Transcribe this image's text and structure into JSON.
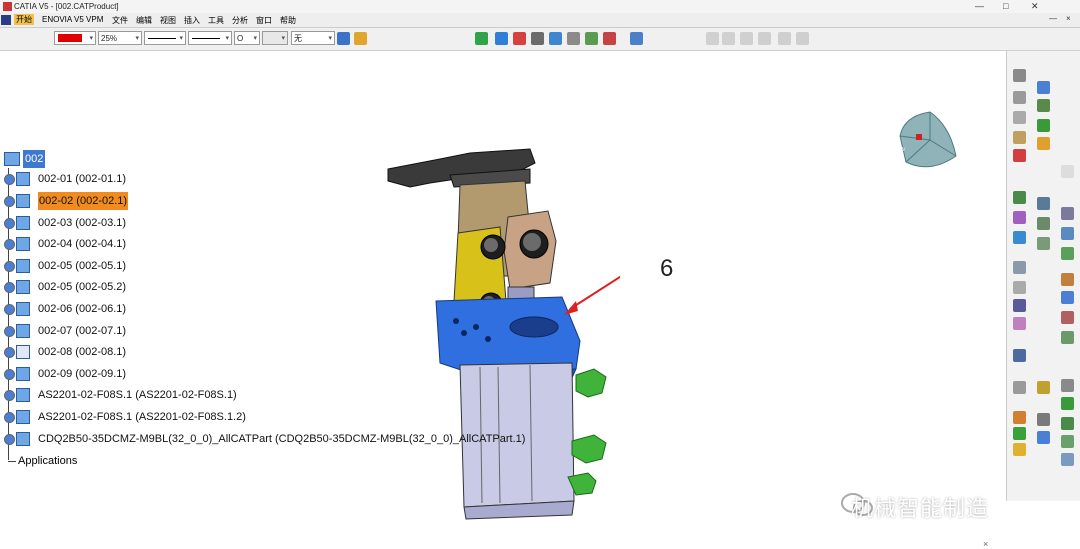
{
  "window": {
    "title": "CATIA V5 - [002.CATProduct]",
    "controls": [
      "—",
      "□",
      "✕"
    ]
  },
  "menu": {
    "start": "开始",
    "items": [
      "ENOVIA V5 VPM",
      "文件",
      "编辑",
      "视图",
      "插入",
      "工具",
      "分析",
      "窗口",
      "帮助"
    ],
    "right_controls": [
      "—",
      "×"
    ]
  },
  "toolbar": {
    "color_value": "",
    "color_hex": "#e00000",
    "transparency": "25%",
    "line_thickness": "",
    "line_type": "",
    "point_type": "O",
    "layer": "无"
  },
  "tree": {
    "root": "002",
    "items": [
      {
        "label": "002-01 (002-01.1)",
        "highlight": false
      },
      {
        "label": "002-02 (002-02.1)",
        "highlight": true
      },
      {
        "label": "002-03 (002-03.1)",
        "highlight": false
      },
      {
        "label": "002-04 (002-04.1)",
        "highlight": false
      },
      {
        "label": "002-05 (002-05.1)",
        "highlight": false
      },
      {
        "label": "002-05 (002-05.2)",
        "highlight": false
      },
      {
        "label": "002-06 (002-06.1)",
        "highlight": false
      },
      {
        "label": "002-07 (002-07.1)",
        "highlight": false
      },
      {
        "label": "002-08 (002-08.1)",
        "highlight": false
      },
      {
        "label": "002-09 (002-09.1)",
        "highlight": false
      },
      {
        "label": "AS2201-02-F08S.1 (AS2201-02-F08S.1)",
        "highlight": false
      },
      {
        "label": "AS2201-02-F08S.1 (AS2201-02-F08S.1.2)",
        "highlight": false
      },
      {
        "label": "CDQ2B50-35DCMZ-M9BL(32_0_0)_AllCATPart (CDQ2B50-35DCMZ-M9BL(32_0_0)_AllCATPart.1)",
        "highlight": false
      }
    ],
    "applications": "Applications"
  },
  "viewport": {
    "callout_number": "6",
    "watermark": "机械智能制造"
  },
  "colors": {
    "highlight": "#f08c1f",
    "selected_root": "#3f79cf",
    "part_blue": "#2f6fe0",
    "part_yellow": "#d8c21a",
    "part_green": "#3fb33a",
    "arrow_red": "#e02020"
  }
}
